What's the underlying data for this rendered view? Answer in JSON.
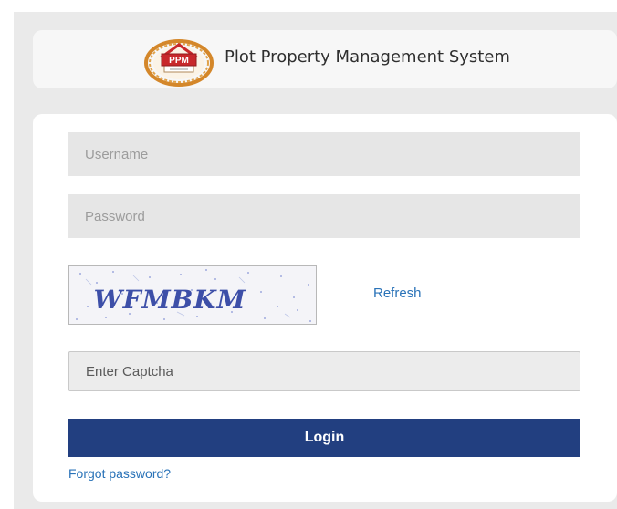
{
  "header": {
    "logo_text": "PPM",
    "title": "Plot Property Management System"
  },
  "login_form": {
    "username_placeholder": "Username",
    "password_placeholder": "Password",
    "captcha_image_text": "WFMBKM",
    "refresh_label": "Refresh",
    "captcha_placeholder": "Enter Captcha",
    "login_label": "Login",
    "forgot_password_label": "Forgot password?"
  },
  "colors": {
    "login_button": "#223f80",
    "link": "#2a73b8",
    "logo_ring": "#d4872a",
    "logo_badge": "#c8282b",
    "field_background": "#e6e6e6"
  }
}
